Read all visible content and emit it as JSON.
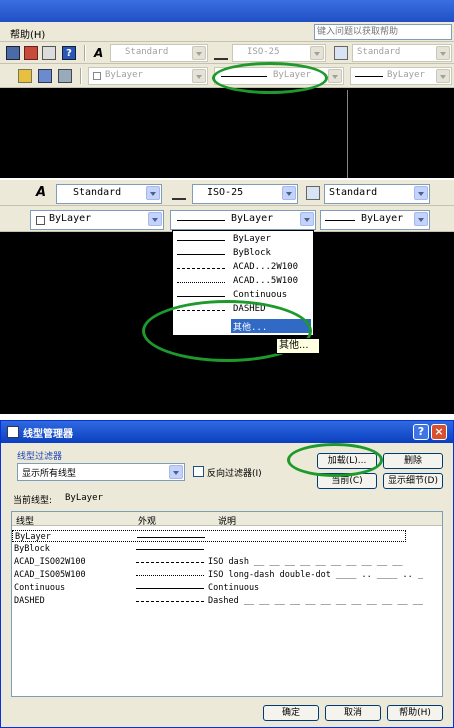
{
  "top": {
    "menu": {
      "help": "帮助(H)"
    },
    "help_search_placeholder": "键入问题以获取帮助",
    "text_style": "Standard",
    "dim_style": "ISO-25",
    "table_style": "Standard",
    "layer_color": "ByLayer",
    "linetype": "ByLayer",
    "lineweight": "ByLayer"
  },
  "middle": {
    "text_style": "Standard",
    "dim_style": "ISO-25",
    "table_style": "Standard",
    "layer_color": "ByLayer",
    "linetype": "ByLayer",
    "lineweight": "ByLayer",
    "dropdown_items": [
      "ByLayer",
      "ByBlock",
      "ACAD...2W100",
      "ACAD...5W100",
      "Continuous",
      "DASHED",
      "其他..."
    ],
    "tooltip": "其他..."
  },
  "dialog": {
    "title": "线型管理器",
    "filter_group": "线型过滤器",
    "filter_value": "显示所有线型",
    "invert_filter": "反向过滤器(I)",
    "load_button": "加载(L)...",
    "delete_button": "删除",
    "current_button": "当前(C)",
    "details_button": "显示细节(D)",
    "current_linetype_label": "当前线型:",
    "current_linetype_value": "ByLayer",
    "columns": {
      "linetype": "线型",
      "appearance": "外观",
      "description": "说明"
    },
    "rows": [
      {
        "name": "ByLayer",
        "desc": ""
      },
      {
        "name": "ByBlock",
        "desc": ""
      },
      {
        "name": "ACAD_ISO02W100",
        "desc": "ISO dash __ __ __ __ __ __ __ __ __ __"
      },
      {
        "name": "ACAD_ISO05W100",
        "desc": "ISO long-dash double-dot ____ .. ____ .. _"
      },
      {
        "name": "Continuous",
        "desc": "Continuous"
      },
      {
        "name": "DASHED",
        "desc": "Dashed __ __ __ __ __ __ __ __ __ __ __ __"
      }
    ],
    "ok_button": "确定",
    "cancel_button": "取消",
    "help_button": "帮助(H)"
  }
}
